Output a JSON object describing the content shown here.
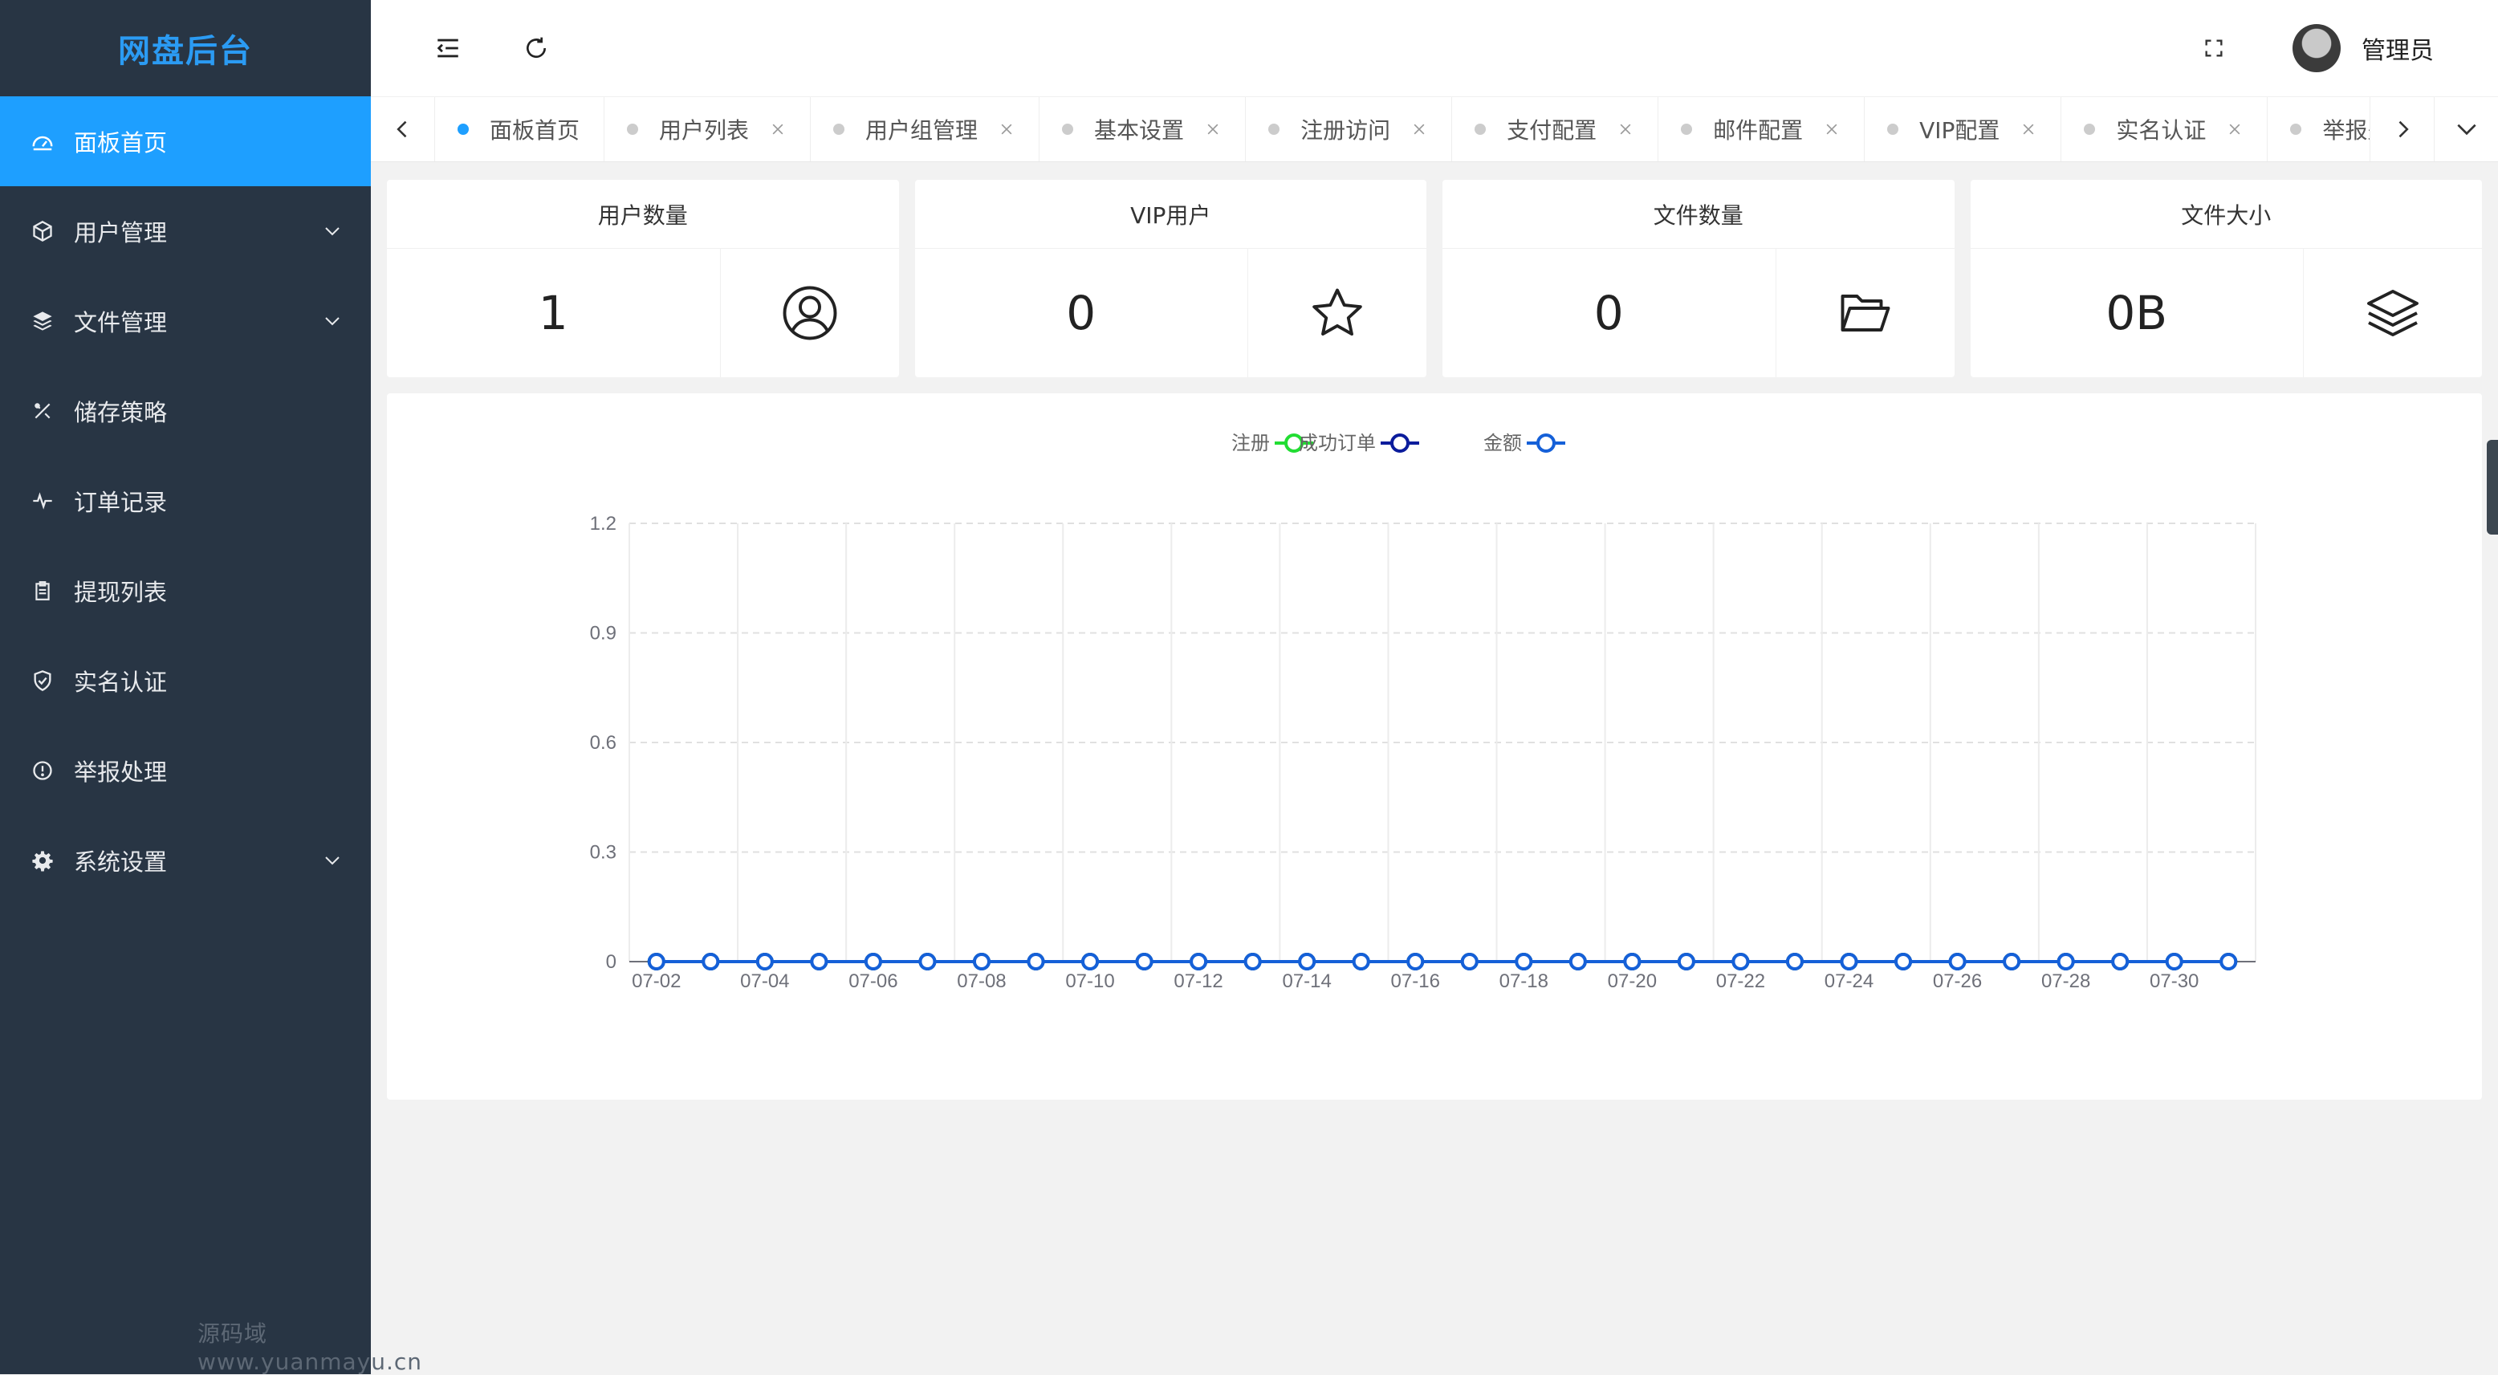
{
  "app": {
    "title": "网盘后台",
    "watermark": "源码域 www.yuanmayu.cn"
  },
  "sidebar": {
    "items": [
      {
        "label": "面板首页",
        "icon": "dashboard-icon",
        "active": true,
        "has_submenu": false
      },
      {
        "label": "用户管理",
        "icon": "cube-icon",
        "active": false,
        "has_submenu": true
      },
      {
        "label": "文件管理",
        "icon": "layers-icon",
        "active": false,
        "has_submenu": true
      },
      {
        "label": "储存策略",
        "icon": "tools-icon",
        "active": false,
        "has_submenu": false
      },
      {
        "label": "订单记录",
        "icon": "pulse-icon",
        "active": false,
        "has_submenu": false
      },
      {
        "label": "提现列表",
        "icon": "clipboard-icon",
        "active": false,
        "has_submenu": false
      },
      {
        "label": "实名认证",
        "icon": "shield-check-icon",
        "active": false,
        "has_submenu": false
      },
      {
        "label": "举报处理",
        "icon": "info-icon",
        "active": false,
        "has_submenu": false
      },
      {
        "label": "系统设置",
        "icon": "gear-icon",
        "active": false,
        "has_submenu": true
      }
    ]
  },
  "header": {
    "user_name": "管理员"
  },
  "tabs": [
    {
      "label": "面板首页",
      "active": true,
      "closable": false
    },
    {
      "label": "用户列表",
      "active": false,
      "closable": true
    },
    {
      "label": "用户组管理",
      "active": false,
      "closable": true
    },
    {
      "label": "基本设置",
      "active": false,
      "closable": true
    },
    {
      "label": "注册访问",
      "active": false,
      "closable": true
    },
    {
      "label": "支付配置",
      "active": false,
      "closable": true
    },
    {
      "label": "邮件配置",
      "active": false,
      "closable": true
    },
    {
      "label": "VIP配置",
      "active": false,
      "closable": true
    },
    {
      "label": "实名认证",
      "active": false,
      "closable": true
    },
    {
      "label": "举报处理",
      "active": false,
      "closable": true
    }
  ],
  "stats": [
    {
      "title": "用户数量",
      "value": "1",
      "icon": "user-circle-icon"
    },
    {
      "title": "VIP用户",
      "value": "0",
      "icon": "star-icon"
    },
    {
      "title": "文件数量",
      "value": "0",
      "icon": "folder-open-icon"
    },
    {
      "title": "文件大小",
      "value": "0B",
      "icon": "layers-icon"
    }
  ],
  "colors": {
    "sidebar_bg": "#283544",
    "accent": "#1e9fff",
    "logo": "#2b9bf3",
    "series_register": "#22dd33",
    "series_orders": "#0b1c9c",
    "series_amount": "#1560d8"
  },
  "chart_data": {
    "type": "line",
    "title": "",
    "xlabel": "",
    "ylabel": "",
    "ylim": [
      0,
      1.2
    ],
    "yticks": [
      "0",
      "0.3",
      "0.6",
      "0.9",
      "1.2"
    ],
    "x": [
      "07-02",
      "07-03",
      "07-04",
      "07-05",
      "07-06",
      "07-07",
      "07-08",
      "07-09",
      "07-10",
      "07-11",
      "07-12",
      "07-13",
      "07-14",
      "07-15",
      "07-16",
      "07-17",
      "07-18",
      "07-19",
      "07-20",
      "07-21",
      "07-22",
      "07-23",
      "07-24",
      "07-25",
      "07-26",
      "07-27",
      "07-28",
      "07-29",
      "07-30",
      "07-31"
    ],
    "xtick_labels": [
      "07-02",
      "07-04",
      "07-06",
      "07-08",
      "07-10",
      "07-12",
      "07-14",
      "07-16",
      "07-18",
      "07-20",
      "07-22",
      "07-24",
      "07-26",
      "07-28",
      "07-30"
    ],
    "legend_position": "top-center",
    "grid": true,
    "series": [
      {
        "name": "注册",
        "color": "#22dd33",
        "values": [
          0,
          0,
          0,
          0,
          0,
          0,
          0,
          0,
          0,
          0,
          0,
          0,
          0,
          0,
          0,
          0,
          0,
          0,
          0,
          0,
          0,
          0,
          0,
          0,
          0,
          0,
          0,
          0,
          0,
          0
        ]
      },
      {
        "name": "成功订单",
        "color": "#0b1c9c",
        "values": [
          0,
          0,
          0,
          0,
          0,
          0,
          0,
          0,
          0,
          0,
          0,
          0,
          0,
          0,
          0,
          0,
          0,
          0,
          0,
          0,
          0,
          0,
          0,
          0,
          0,
          0,
          0,
          0,
          0,
          0
        ]
      },
      {
        "name": "金额",
        "color": "#1560d8",
        "values": [
          0,
          0,
          0,
          0,
          0,
          0,
          0,
          0,
          0,
          0,
          0,
          0,
          0,
          0,
          0,
          0,
          0,
          0,
          0,
          0,
          0,
          0,
          0,
          0,
          0,
          0,
          0,
          0,
          0,
          0
        ]
      }
    ]
  }
}
